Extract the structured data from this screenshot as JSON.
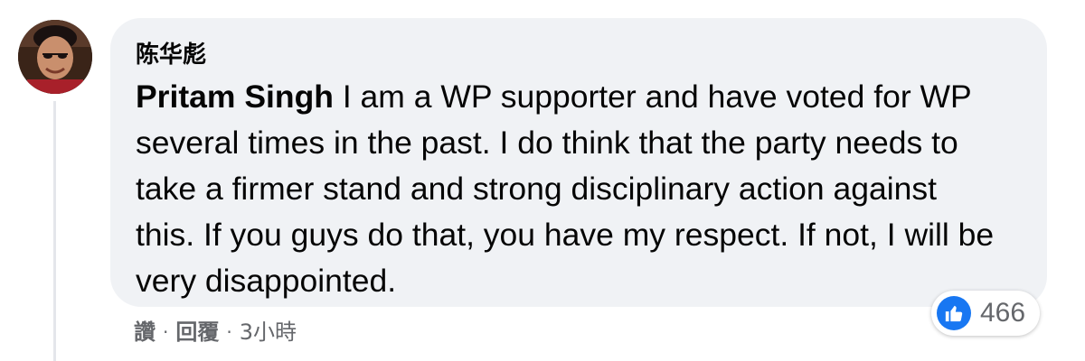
{
  "comment": {
    "author": "陈华彪",
    "mention": "Pritam Singh",
    "text": " I am a WP supporter and have voted for WP several times in the past. I do think that the party needs to take a firmer stand and strong disciplinary action against this. If you guys do that, you have my respect. If not, I will be very disappointed.",
    "actions": {
      "like_label": "讚",
      "reply_label": "回覆",
      "separator": "·",
      "timestamp": "3小時"
    },
    "reactions": {
      "icon": "thumbs-up-icon",
      "count": "466",
      "color": "#1877f2"
    }
  }
}
